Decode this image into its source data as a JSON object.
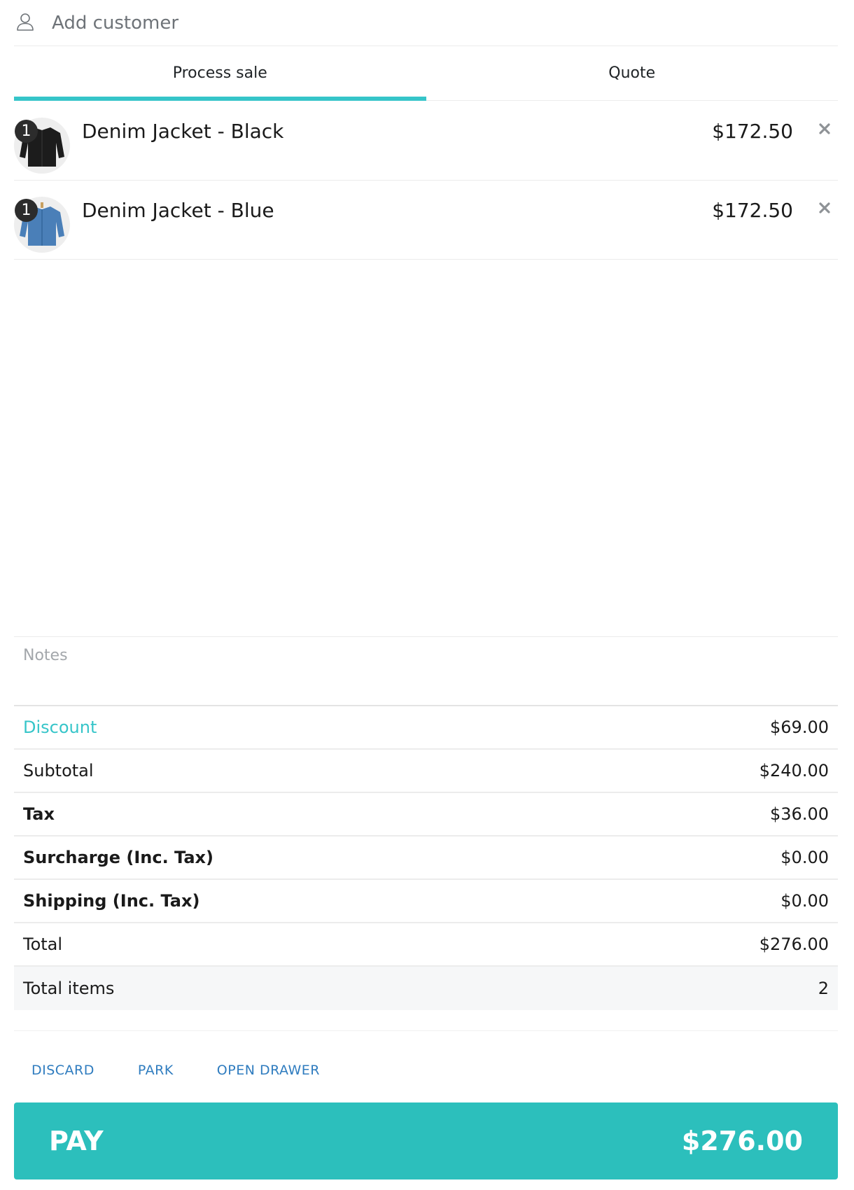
{
  "customer": {
    "label": "Add customer",
    "icon": "user-icon"
  },
  "tabs": [
    {
      "label": "Process sale",
      "active": true
    },
    {
      "label": "Quote",
      "active": false
    }
  ],
  "items": [
    {
      "qty": "1",
      "name": "Denim Jacket - Black",
      "price": "$172.50",
      "color": "#1c1c1c"
    },
    {
      "qty": "1",
      "name": "Denim Jacket - Blue",
      "price": "$172.50",
      "color": "#4a7fb8"
    }
  ],
  "notes": {
    "placeholder": "Notes"
  },
  "totals": {
    "discount": {
      "label": "Discount",
      "value": "$69.00"
    },
    "subtotal": {
      "label": "Subtotal",
      "value": "$240.00"
    },
    "tax": {
      "label": "Tax",
      "value": "$36.00"
    },
    "surcharge": {
      "label": "Surcharge (Inc. Tax)",
      "value": "$0.00"
    },
    "shipping": {
      "label": "Shipping (Inc. Tax)",
      "value": "$0.00"
    },
    "total": {
      "label": "Total",
      "value": "$276.00"
    },
    "total_items": {
      "label": "Total items",
      "value": "2"
    }
  },
  "actions": {
    "discard": "DISCARD",
    "park": "PARK",
    "open_drawer": "OPEN DRAWER"
  },
  "pay": {
    "label": "PAY",
    "amount": "$276.00"
  },
  "colors": {
    "accent": "#36c5c9",
    "pay_button": "#2cbfbc",
    "link": "#2f7cbf"
  }
}
